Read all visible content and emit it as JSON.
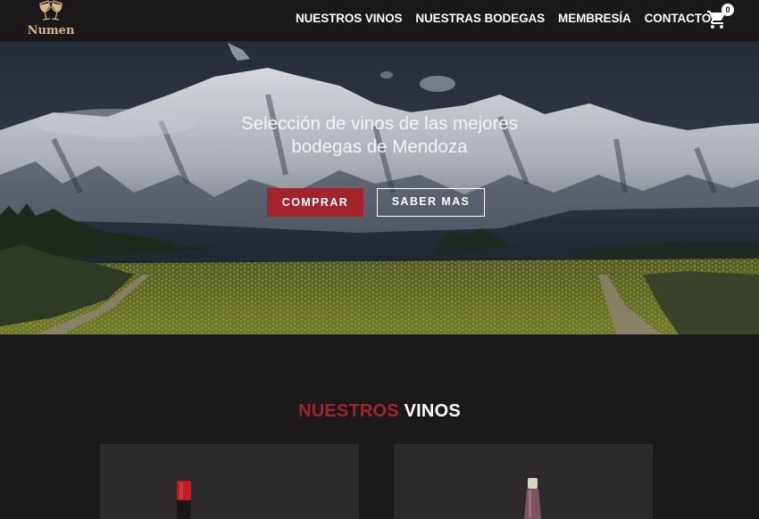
{
  "brand": {
    "name": "Numen"
  },
  "nav": {
    "items": [
      {
        "label": "NUESTROS VINOS"
      },
      {
        "label": "NUESTRAS BODEGAS"
      },
      {
        "label": "MEMBRESÍA"
      },
      {
        "label": "CONTACTO"
      }
    ],
    "cart_count": "0",
    "cart_icon": "shopping-cart-icon"
  },
  "hero": {
    "title_line1": "Selección de vinos de las mejores",
    "title_line2": "bodegas de Mendoza",
    "buy_label": "COMPRAR",
    "more_label": "SABER MAS"
  },
  "section": {
    "title_accent": "NUESTROS",
    "title_rest": "VINOS"
  },
  "products": [
    {
      "image": "red-wine-bottle"
    },
    {
      "image": "rose-wine-bottle"
    }
  ],
  "colors": {
    "accent": "#a2232b",
    "background": "#1b191a",
    "card": "#2c2a2b",
    "logo": "#d9b98a"
  }
}
